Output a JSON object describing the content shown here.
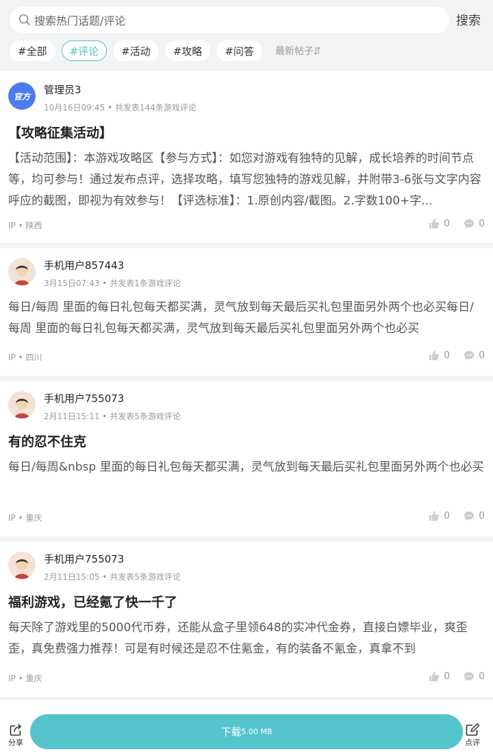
{
  "search": {
    "placeholder": "搜索热门话题/评论",
    "button": "搜索"
  },
  "tabs": [
    {
      "label": "#全部"
    },
    {
      "label": "#评论",
      "active": true
    },
    {
      "label": "#活动"
    },
    {
      "label": "#攻略"
    },
    {
      "label": "#问答"
    }
  ],
  "sort_label": "最新帖子",
  "posts": [
    {
      "avatar_text": "官方",
      "user": "管理员3",
      "meta": "10月16日09:45 • 共发表144条游戏评论",
      "title": "【攻略征集活动】",
      "content": "【活动范围】：本游戏攻略区【参与方式】：如您对游戏有独特的见解，成长培养的时间节点等，均可参与！通过发布点评，选择攻略，填写您独特的游戏见解，并附带3-6张与文字内容呼应的截图，即视为有效参与！【评选标准】：1.原创内容/截图。2.字数100+字...",
      "ip": "IP • 陕西",
      "likes": "0",
      "comments": "0"
    },
    {
      "user": "手机用户857443",
      "meta": "3月15日07:43 • 共发表1条游戏评论",
      "content": "每日/每周 里面的每日礼包每天都买满，灵气放到每天最后买礼包里面另外两个也必买每日/每周 里面的每日礼包每天都买满，灵气放到每天最后买礼包里面另外两个也必买",
      "ip": "IP • 四川",
      "likes": "0",
      "comments": "0"
    },
    {
      "user": "手机用户755073",
      "meta": "2月11日15:11 • 共发表5条游戏评论",
      "title": "有的忍不住克",
      "content": "每日/每周&nbsp 里面的每日礼包每天都买满，灵气放到每天最后买礼包里面另外两个也必买",
      "ip": "IP • 重庆",
      "likes": "0",
      "comments": "0"
    },
    {
      "user": "手机用户755073",
      "meta": "2月11日15:05 • 共发表5条游戏评论",
      "title": "福利游戏，已经氪了快一千了",
      "content": "每天除了游戏里的5000代币券，还能从盒子里领648的实冲代金券，直接白嫖毕业，爽歪歪，真免费强力推荐！可是有时候还是忍不住氪金，有的装备不氪金，真拿不到",
      "ip": "IP • 重庆",
      "likes": "0",
      "comments": "0"
    }
  ],
  "bottom": {
    "share": "分享",
    "download": "下载",
    "download_size": "5.00 MB",
    "review": "点评"
  },
  "colors": {
    "accent": "#56c4cd",
    "official_badge": "#4a7cf0"
  },
  "icons": [
    "search-icon",
    "sort-icon",
    "thumb-up-icon",
    "comment-icon",
    "share-icon",
    "edit-icon"
  ]
}
